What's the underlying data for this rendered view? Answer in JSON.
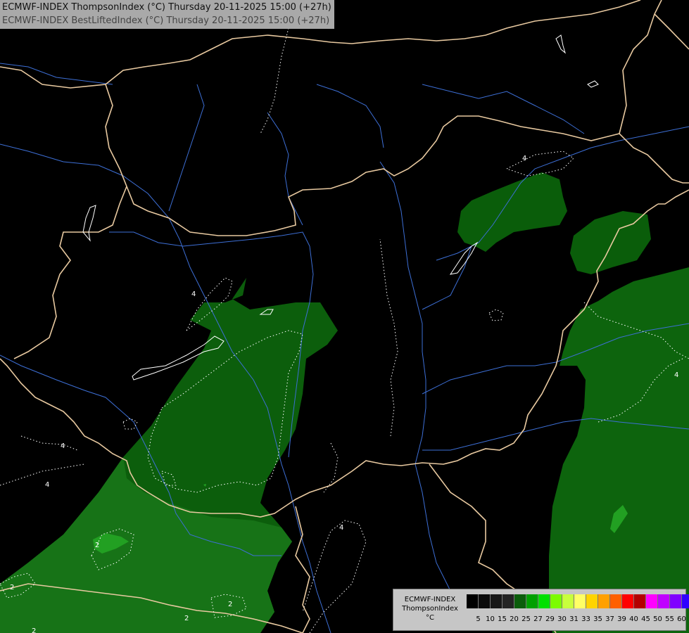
{
  "header": {
    "line1": "ECMWF-INDEX ThompsonIndex (°C) Thursday 20-11-2025 15:00 (+27h)",
    "line2": "ECMWF-INDEX BestLiftedIndex (°C) Thursday 20-11-2025 15:00 (+27h)"
  },
  "legend": {
    "line1": "ECMWF-INDEX",
    "line2": "ThompsonIndex",
    "unit": "°C",
    "ticks": [
      "5",
      "10",
      "15",
      "20",
      "25",
      "27",
      "29",
      "30",
      "31",
      "33",
      "35",
      "37",
      "39",
      "40",
      "45",
      "50",
      "55",
      "60"
    ],
    "colors": [
      "#000000",
      "#0c0c0c",
      "#181818",
      "#242424",
      "#0b5d0b",
      "#00a000",
      "#00e000",
      "#7cfc00",
      "#c8ff3c",
      "#ffff66",
      "#ffd400",
      "#ffa000",
      "#ff6000",
      "#ff0000",
      "#b40000",
      "#ff00ff",
      "#c000ff",
      "#8000ff",
      "#3000ff",
      "#0000ff"
    ]
  },
  "contour_labels": [
    "4",
    "4",
    "4",
    "4",
    "4",
    "4",
    "2",
    "2",
    "2",
    "2",
    "2"
  ],
  "map_colors": {
    "background": "#000000",
    "dark_green": "#055205",
    "mid_green": "#0a5f0a",
    "light_green": "#1a7d1a",
    "bright_green": "#1fa31f",
    "borders": "#e8c9a0",
    "rivers": "#3d6fd6",
    "contours": "#ffffff"
  }
}
